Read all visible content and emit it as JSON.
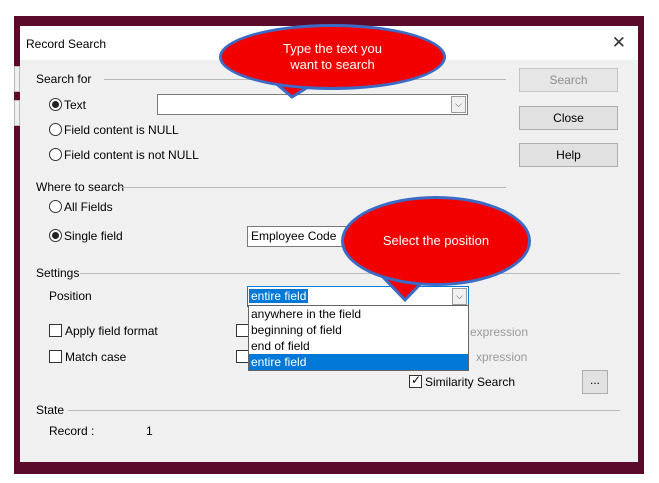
{
  "window": {
    "title": "Record Search",
    "close_glyph": "✕"
  },
  "search_for": {
    "heading": "Search for",
    "text_option": "Text",
    "text_value": "",
    "null_option": "Field content is NULL",
    "not_null_option": "Field content is not NULL"
  },
  "buttons": {
    "search": "Search",
    "close": "Close",
    "help": "Help",
    "ellipsis": "..."
  },
  "where_to_search": {
    "heading": "Where to search",
    "all_fields": "All Fields",
    "single_field": "Single field",
    "field_value": "Employee Code"
  },
  "settings": {
    "heading": "Settings",
    "position_label": "Position",
    "position_value": "entire field",
    "position_options": [
      "anywhere in the field",
      "beginning of field",
      "end of field",
      "entire field"
    ],
    "apply_field_format": "Apply field format",
    "match_case": "Match case",
    "regex_partial_1": "expression",
    "regex_partial_2": "xpression",
    "similarity_search": "Similarity Search"
  },
  "state": {
    "heading": "State",
    "record_label": "Record :",
    "record_value": "1"
  },
  "callouts": {
    "top": "Type the text you want to search",
    "middle": "Select the position"
  },
  "colors": {
    "callout_fill": "#f20000",
    "callout_border": "#3b6bc7",
    "frame": "#5c0a2c",
    "highlight": "#0078d7"
  }
}
